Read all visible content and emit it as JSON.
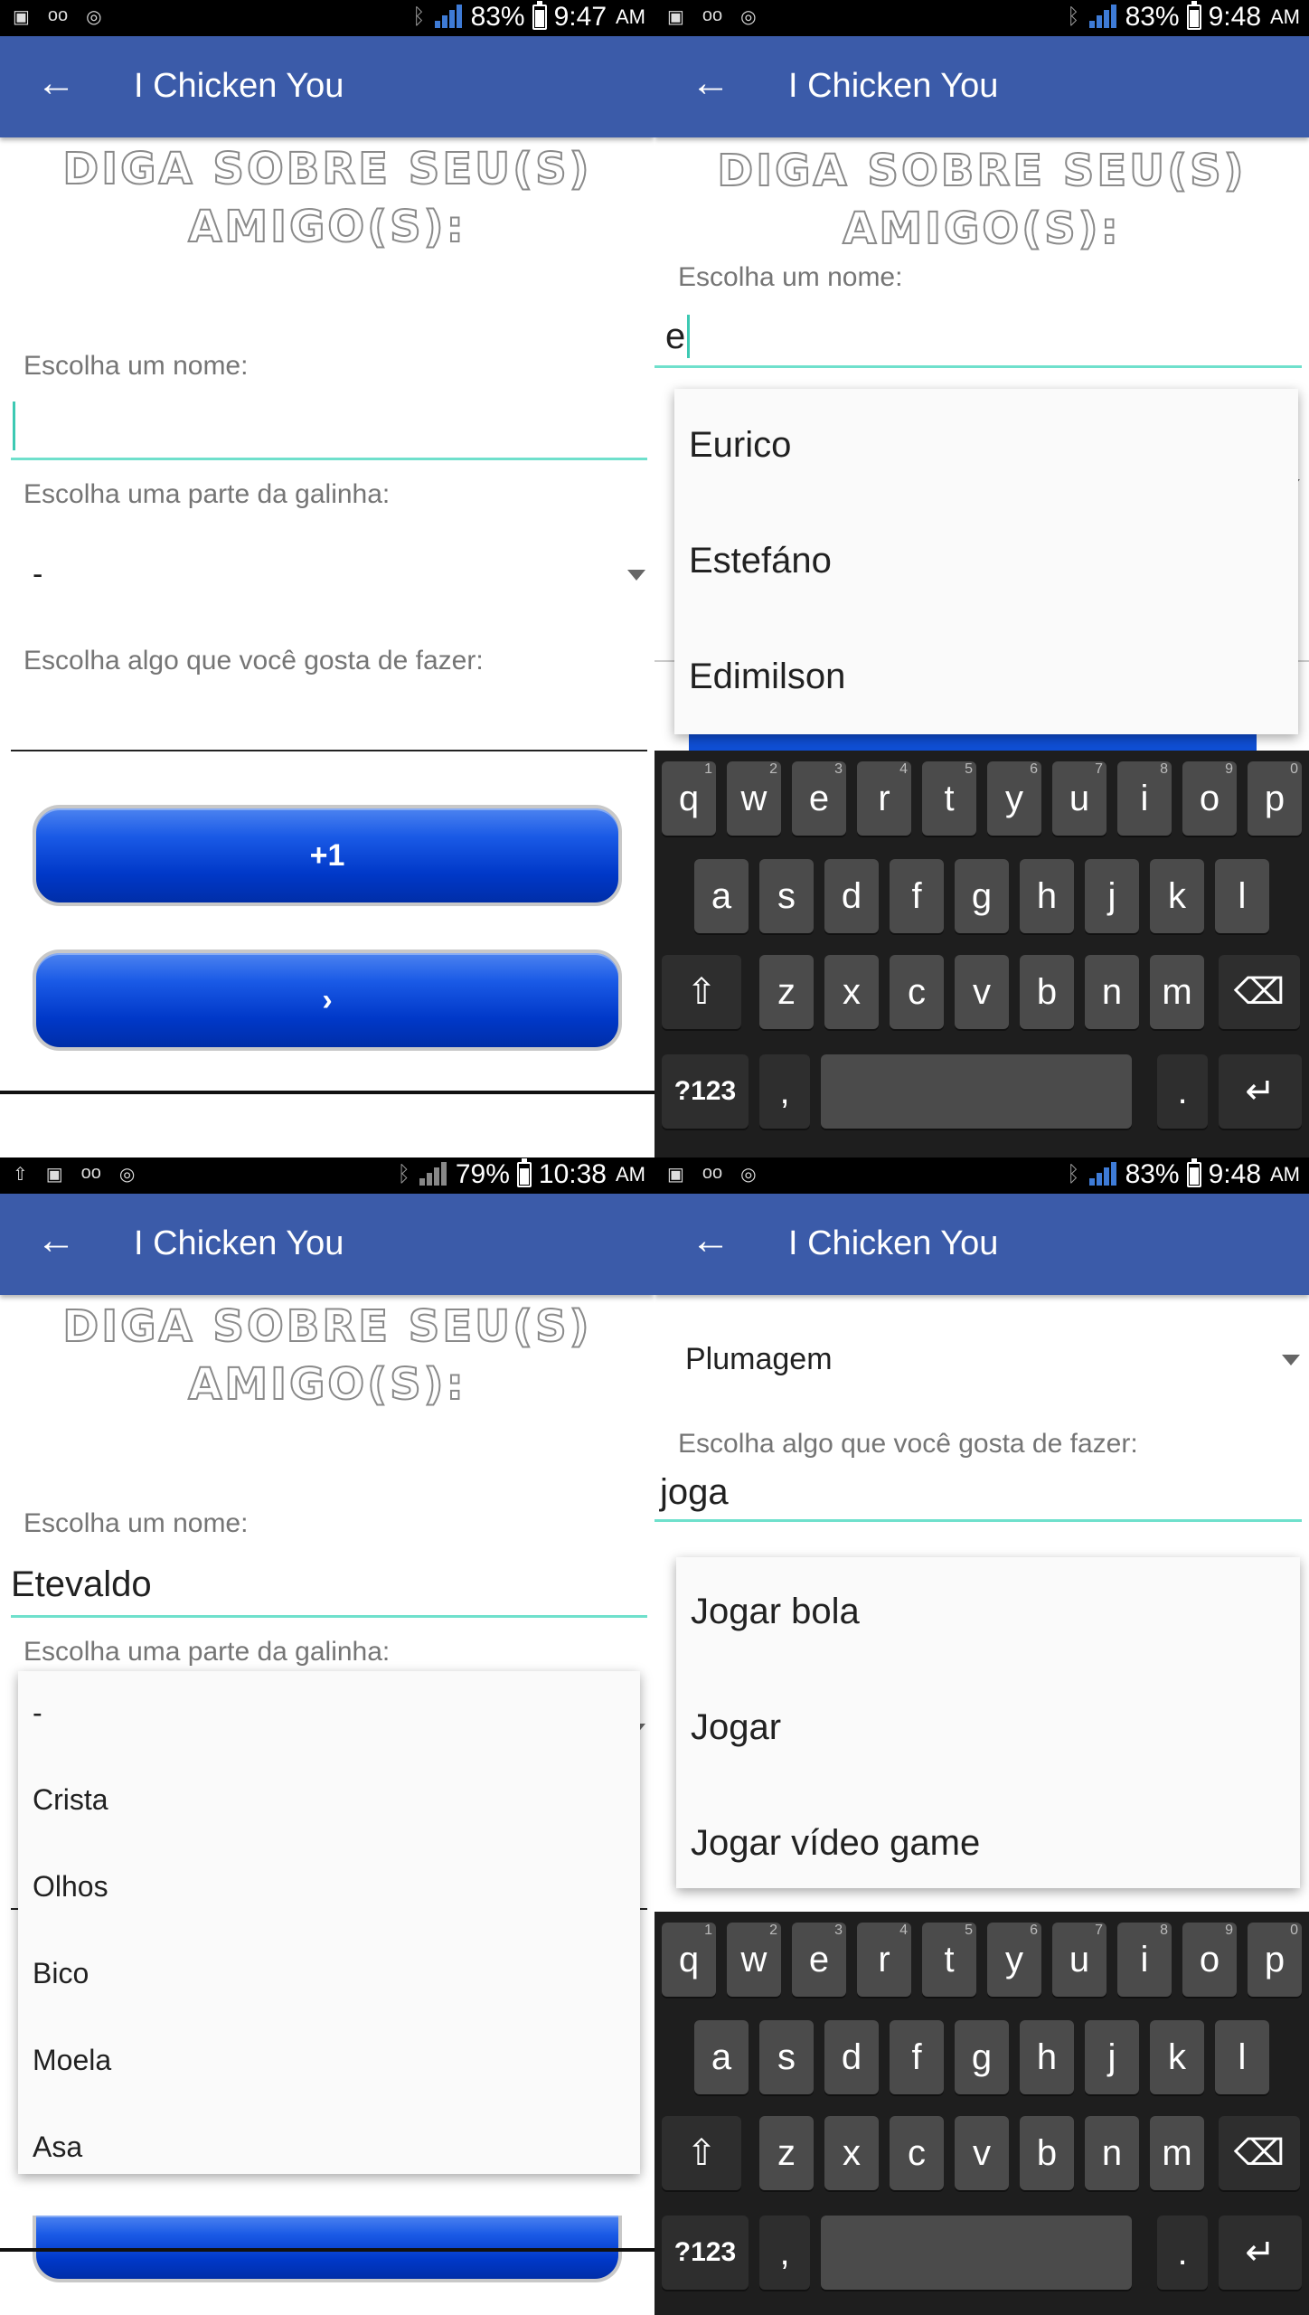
{
  "app_title": "I Chicken You",
  "heading_line1": "DIGA SOBRE SEU(S)",
  "heading_line2": "AMIGO(S):",
  "labels": {
    "name": "Escolha um nome:",
    "part": "Escolha uma parte da galinha:",
    "hobby": "Escolha algo que você gosta de fazer:"
  },
  "buttons": {
    "plus_one": "+1",
    "next": "›"
  },
  "panels": [
    {
      "status": {
        "battery": "83%",
        "time": "9:47",
        "ampm": "AM"
      },
      "part_value": "-"
    },
    {
      "status": {
        "battery": "83%",
        "time": "9:48",
        "ampm": "AM"
      },
      "name_value": "e",
      "suggestions": [
        "Eurico",
        "Estefáno",
        "Edimilson"
      ]
    },
    {
      "status": {
        "battery": "79%",
        "time": "10:38",
        "ampm": "AM"
      },
      "name_value": "Etevaldo",
      "part_options": [
        "-",
        "Crista",
        "Olhos",
        "Bico",
        "Moela",
        "Asa"
      ]
    },
    {
      "status": {
        "battery": "83%",
        "time": "9:48",
        "ampm": "AM"
      },
      "part_value": "Plumagem",
      "hobby_value": "joga",
      "suggestions": [
        "Jogar bola",
        "Jogar",
        "Jogar vídeo game"
      ]
    }
  ],
  "keyboard": {
    "row1": [
      "q",
      "w",
      "e",
      "r",
      "t",
      "y",
      "u",
      "i",
      "o",
      "p"
    ],
    "row1_hints": [
      "1",
      "2",
      "3",
      "4",
      "5",
      "6",
      "7",
      "8",
      "9",
      "0"
    ],
    "row2": [
      "a",
      "s",
      "d",
      "f",
      "g",
      "h",
      "j",
      "k",
      "l"
    ],
    "row3": [
      "z",
      "x",
      "c",
      "v",
      "b",
      "n",
      "m"
    ],
    "sym_key": "?123",
    "comma": ",",
    "period": ".",
    "shift_icon": "⇧",
    "backspace_icon": "⌫",
    "enter_icon": "↵"
  },
  "icons": {
    "back": "←"
  },
  "colors": {
    "appbar": "#3b5ba9",
    "accent": "#6fe0cc",
    "button": "#1a5ae6"
  }
}
